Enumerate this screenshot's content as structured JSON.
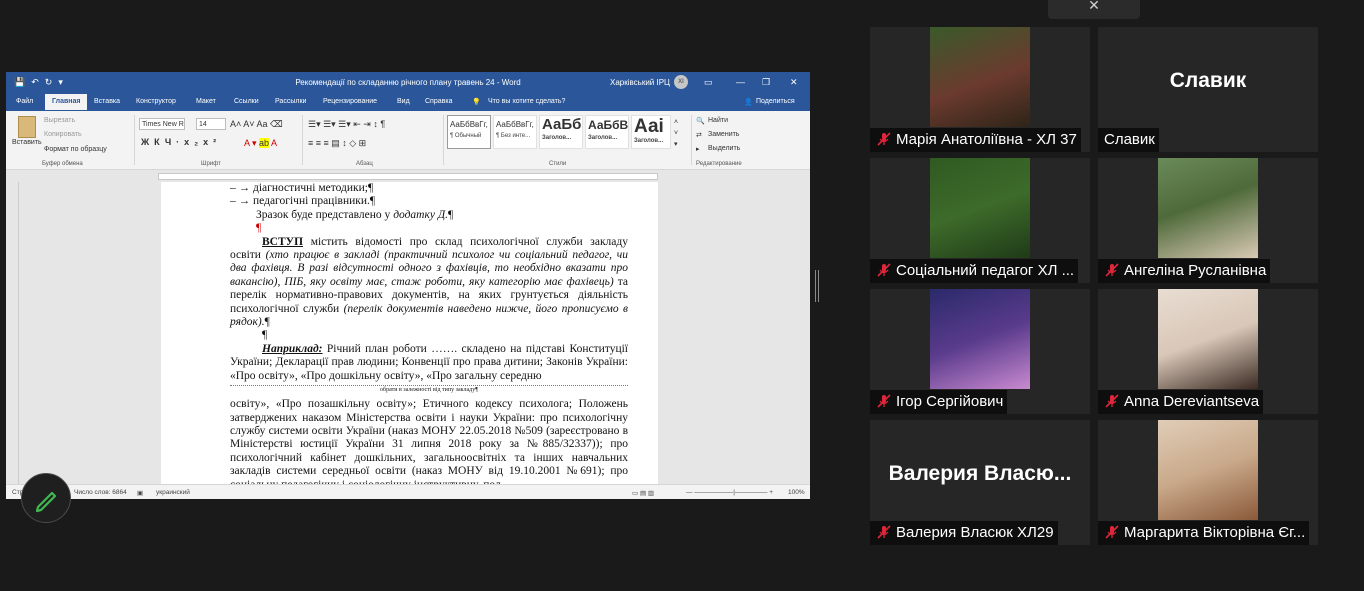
{
  "window": {
    "title": "Рекомендації по складанню річного плану травень 24  -  Word",
    "user": "Харківський ІРЦ",
    "user_initials": "ХІ"
  },
  "ribbon_tabs": [
    {
      "label": "Файл"
    },
    {
      "label": "Главная"
    },
    {
      "label": "Вставка"
    },
    {
      "label": "Конструктор"
    },
    {
      "label": "Макет"
    },
    {
      "label": "Ссылки"
    },
    {
      "label": "Рассылки"
    },
    {
      "label": "Рецензирование"
    },
    {
      "label": "Вид"
    },
    {
      "label": "Справка"
    }
  ],
  "tell_me": "Что вы хотите сделать?",
  "share_label": "Поделиться",
  "clipboard": {
    "paste": "Вставить",
    "cut": "Вырезать",
    "copy": "Копировать",
    "format_painter": "Формат по образцу",
    "group": "Буфер обмена"
  },
  "font": {
    "name": "Times New R",
    "size": "14",
    "group": "Шрифт"
  },
  "paragraph_group": "Абзац",
  "styles": {
    "group": "Стили",
    "items": [
      {
        "preview": "АаБбВвГг,",
        "label": "¶ Обычный"
      },
      {
        "preview": "АаБбВвГг,",
        "label": "¶ Без инте..."
      },
      {
        "preview": "АаБб",
        "label": "Заголов..."
      },
      {
        "preview": "АаБбВ",
        "label": "Заголов..."
      },
      {
        "preview": "Ааі",
        "label": "Заголов..."
      }
    ]
  },
  "editing": {
    "find": "Найти",
    "replace": "Заменить",
    "select": "Выделить",
    "group": "Редактирование"
  },
  "document": {
    "l1": "–  →  діагностичні методики;¶",
    "l2": "–  →  педагогічні працівники.¶",
    "l3a": "Зразок буде представлено у ",
    "l3b": "додатку Д.",
    "l3c": "¶",
    "p_mark": "¶",
    "intro_head": "ВСТУП",
    "intro_text1": " містить відомості про склад психологічної служби закладу освіти ",
    "intro_italic1": "(хто працює в закладі (практичний психолог чи соціальний педагог, чи два фахівця. В разі відсутності одного з фахівців, то необхідно вказати про вакансію), ПІБ, яку освіту має, стаж роботи, яку категорію має фахівець)",
    "intro_text2": " та перелік нормативно-правових документів, на яких грунтується діяльність психологічної служби ",
    "intro_italic2": "(перелік документів наведено нижче, його прописуємо в рядок).",
    "intro_end": "¶",
    "p_mark2": "¶",
    "example_head": "Наприклад:",
    "example_text": " Річний план роботи ……. складено на підставі Конституції України; Декларації прав людини; Конвенції про права дитини; Законів України: «Про освіту», «Про дошкільну освіту», «Про загальну середню",
    "comment": "обрати в залежності від типу закладу¶",
    "continue_text": "освіту», «Про позашкільну освіту»; Етичного кодексу психолога; Положень затверджених наказом Міністерства освіти і науки України: про психологічну службу системи освіти України (наказ МОНУ 22.05.2018 №509 (зареєстровано в Міністерстві юстиції України 31 липня 2018 року за №885/32337)); про психологічний кабінет дошкільних, загальноосвітніх та інших навчальних закладів системи середньої освіти (наказ МОНУ від 19.10.2001 №691); про соціальну педагогічну і соціологічну інструктивну, пол"
  },
  "status": {
    "page": "Страница",
    "words": "Число слов: 6864",
    "language": "украинский",
    "zoom": "100%"
  },
  "participants": [
    {
      "name": "Марія Анатоліївна - ХЛ 37",
      "video": true,
      "color": "#6b3a2e"
    },
    {
      "name": "Славик",
      "video": false,
      "big_label": "Славик"
    },
    {
      "name": "Соціальний педагог ХЛ ...",
      "video": true,
      "color": "#3d6b2a"
    },
    {
      "name": "Ангеліна Русланівна",
      "video": true,
      "color": "#4f6a3a"
    },
    {
      "name": "Ігор Сергійович",
      "video": true,
      "color": "#5a3b8c"
    },
    {
      "name": "Anna Dereviantseva",
      "video": true,
      "color": "#d9c7b8"
    },
    {
      "name": "Валерия Власюк ХЛ29",
      "video": false,
      "big_label": "Валерия  Власю..."
    },
    {
      "name": "Маргарита Вікторівна Єг...",
      "video": true,
      "color": "#c9a98a"
    }
  ],
  "colors": {
    "word_blue": "#2b579a",
    "muted_red": "#e0263a",
    "background": "#1a1a1a"
  }
}
